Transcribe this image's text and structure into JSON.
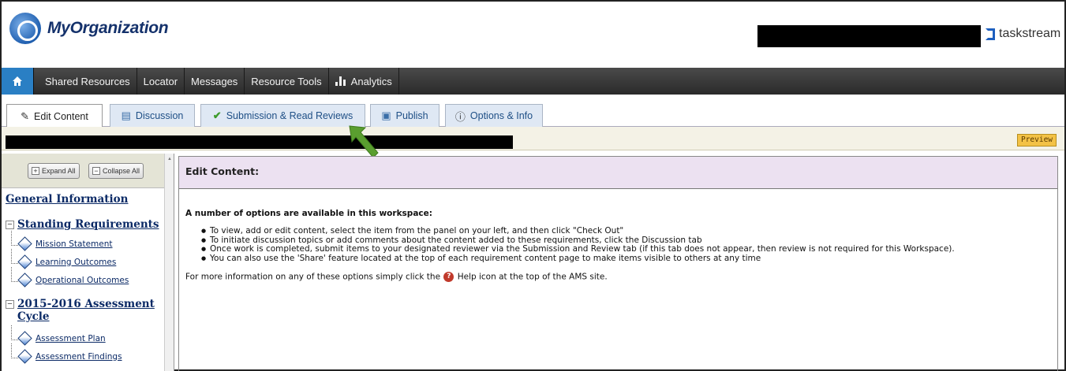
{
  "header": {
    "org_name": "MyOrganization",
    "brand": "taskstream"
  },
  "nav": {
    "items": [
      "Shared Resources",
      "Locator",
      "Messages",
      "Resource Tools",
      "Analytics"
    ]
  },
  "tabs": [
    {
      "label": "Edit Content",
      "icon": "pencil-icon",
      "active": true
    },
    {
      "label": "Discussion",
      "icon": "comment-icon",
      "active": false
    },
    {
      "label": "Submission & Read Reviews",
      "icon": "checkmark-icon",
      "active": false
    },
    {
      "label": "Publish",
      "icon": "publish-icon",
      "active": false
    },
    {
      "label": "Options & Info",
      "icon": "info-icon",
      "active": false
    }
  ],
  "subbar": {
    "preview_label": "Preview"
  },
  "sidebar": {
    "expand_all": "Expand All",
    "collapse_all": "Collapse All",
    "general_info": "General Information",
    "sections": [
      {
        "title": "Standing Requirements",
        "items": [
          "Mission Statement",
          "Learning Outcomes",
          "Operational Outcomes"
        ]
      },
      {
        "title": "2015-2016 Assessment Cycle",
        "items": [
          "Assessment Plan",
          "Assessment Findings"
        ]
      }
    ]
  },
  "main": {
    "heading": "Edit Content:",
    "intro": "A number of options are available in this workspace:",
    "bullets": [
      "To view, add or edit content, select the item from the panel on your left, and then click \"Check Out\"",
      "To initiate discussion topics or add comments about the content added to these requirements, click the Discussion tab",
      "Once work is completed, submit items to your designated reviewer via the Submission and Review tab (if this tab does not appear, then review is not required for this Workspace).",
      "You can also use the 'Share' feature located at the top of each requirement content page to make items visible to others at any time"
    ],
    "footer_before": "For more information on any of these options simply click the",
    "footer_after": "Help icon at the top of the AMS site."
  },
  "colors": {
    "nav_bg": "#333333",
    "home_bg": "#2a7fc4",
    "tab_bg": "#dfe8f4",
    "main_head_bg": "#ece1f1",
    "preview_bg": "#f3c246",
    "arrow": "#5a9e2f"
  }
}
